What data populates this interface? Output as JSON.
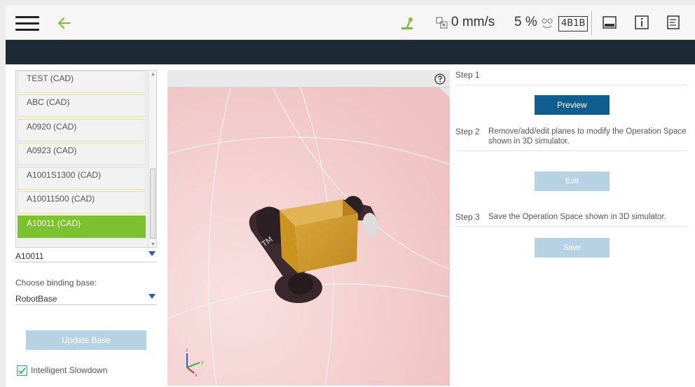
{
  "topbar": {
    "speed_text": "0 mm/s",
    "percent_text": "5 %",
    "project_badge": "4B1B",
    "icons": [
      "menu-icon",
      "back-arrow-icon",
      "jog-icon",
      "speed-icon",
      "slow-mode-icon",
      "display-icon",
      "info-icon",
      "log-icon"
    ]
  },
  "left_panel": {
    "list_items": [
      {
        "label": "TEST  (CAD)"
      },
      {
        "label": "ABC  (CAD)"
      },
      {
        "label": "A0920  (CAD)"
      },
      {
        "label": "A0923  (CAD)"
      },
      {
        "label": "A1001S1300  (CAD)"
      },
      {
        "label": "A10011500  (CAD)"
      },
      {
        "label": "A10011  (CAD)",
        "selected": true
      }
    ],
    "selected_value": "A10011",
    "binding_base_label": "Choose binding base:",
    "binding_base_value": "RobotBase",
    "update_base_label": "Update Base",
    "intelligent_slowdown_label": "Intelligent Slowdown",
    "intelligent_slowdown_checked": true
  },
  "viewer": {
    "help_icon": "help-icon",
    "axis_labels": {
      "x": "x",
      "y": "y",
      "z": "z"
    }
  },
  "right_panel": {
    "step1_label": "Step 1",
    "preview_label": "Preview",
    "step2_label": "Step 2",
    "step2_desc": "Remove/add/edit planes to modify the Operation Space shown in 3D simulator.",
    "edit_label": "Edit",
    "step3_label": "Step 3",
    "step3_desc": "Save the Operation Space shown in 3D simulator.",
    "save_label": "Save"
  },
  "colors": {
    "accent_green": "#7cc230",
    "primary_blue": "#0f5f8e",
    "disabled_blue": "#b7d3e3",
    "header_dark": "#1c2b33",
    "scene_pink": "#f2c9c9"
  }
}
